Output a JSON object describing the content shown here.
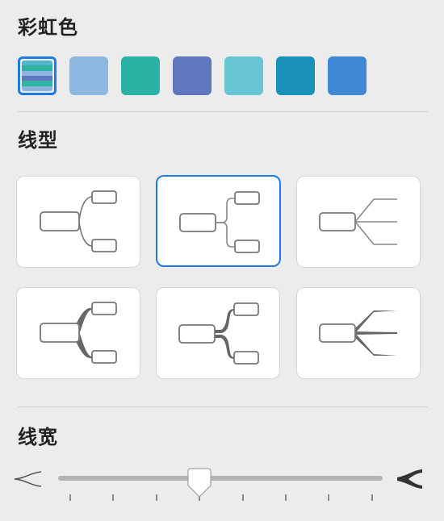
{
  "rainbow_section": {
    "title": "彩虹色",
    "swatches": [
      {
        "name": "rainbow",
        "selected": true,
        "stripes": [
          "#53b7c9",
          "#2fb3a3",
          "#8db4e0",
          "#6076c0",
          "#2fb3a3",
          "#8db4e0"
        ]
      },
      {
        "name": "light-blue",
        "color": "#8fb8e0"
      },
      {
        "name": "teal",
        "color": "#2ab3a4"
      },
      {
        "name": "indigo",
        "color": "#6077bd"
      },
      {
        "name": "cyan",
        "color": "#68c5d4"
      },
      {
        "name": "ocean-blue",
        "color": "#1a91ba"
      },
      {
        "name": "blue",
        "color": "#3f88d5"
      }
    ]
  },
  "line_type_section": {
    "title": "线型",
    "options": [
      {
        "name": "curved",
        "selected": false
      },
      {
        "name": "elbow-rounded",
        "selected": true
      },
      {
        "name": "straight-fan",
        "selected": false
      },
      {
        "name": "curved-tapered",
        "selected": false
      },
      {
        "name": "elbow-tapered",
        "selected": false
      },
      {
        "name": "straight-tapered",
        "selected": false
      }
    ]
  },
  "line_width_section": {
    "title": "线宽",
    "slider": {
      "ticks": 8,
      "value_tick": 3
    },
    "min_icon": "thin-fork-icon",
    "max_icon": "thick-fork-icon"
  },
  "colors": {
    "accent": "#1f7be3"
  }
}
